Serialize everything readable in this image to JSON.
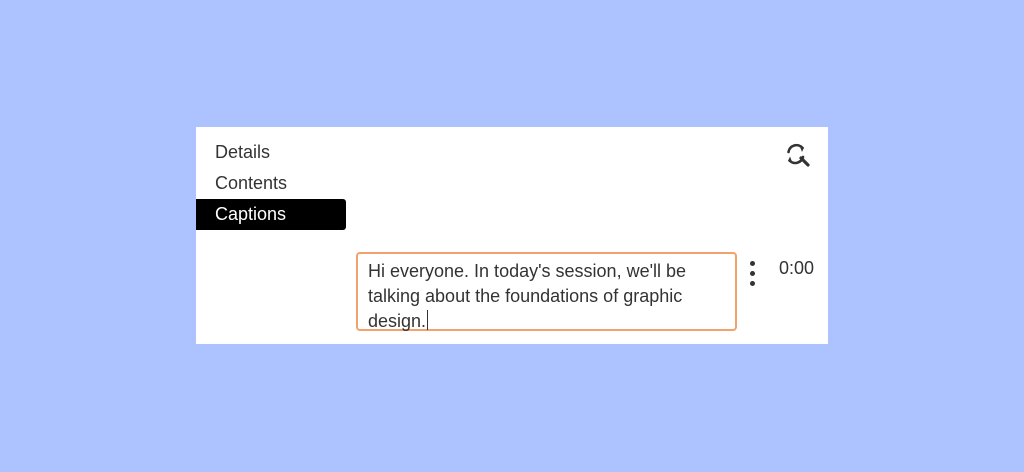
{
  "nav": {
    "items": [
      {
        "label": "Details",
        "active": false
      },
      {
        "label": "Contents",
        "active": false
      },
      {
        "label": "Captions",
        "active": true
      }
    ]
  },
  "toolbar": {
    "search_icon": "search-refresh-icon"
  },
  "caption": {
    "text": "Hi everyone. In today's session, we'll be talking about the foundations of graphic design.",
    "timestamp": "0:00"
  },
  "colors": {
    "background": "#adc3ff",
    "active_nav": "#000000",
    "caption_border": "#f3a26e",
    "text": "#333333"
  }
}
